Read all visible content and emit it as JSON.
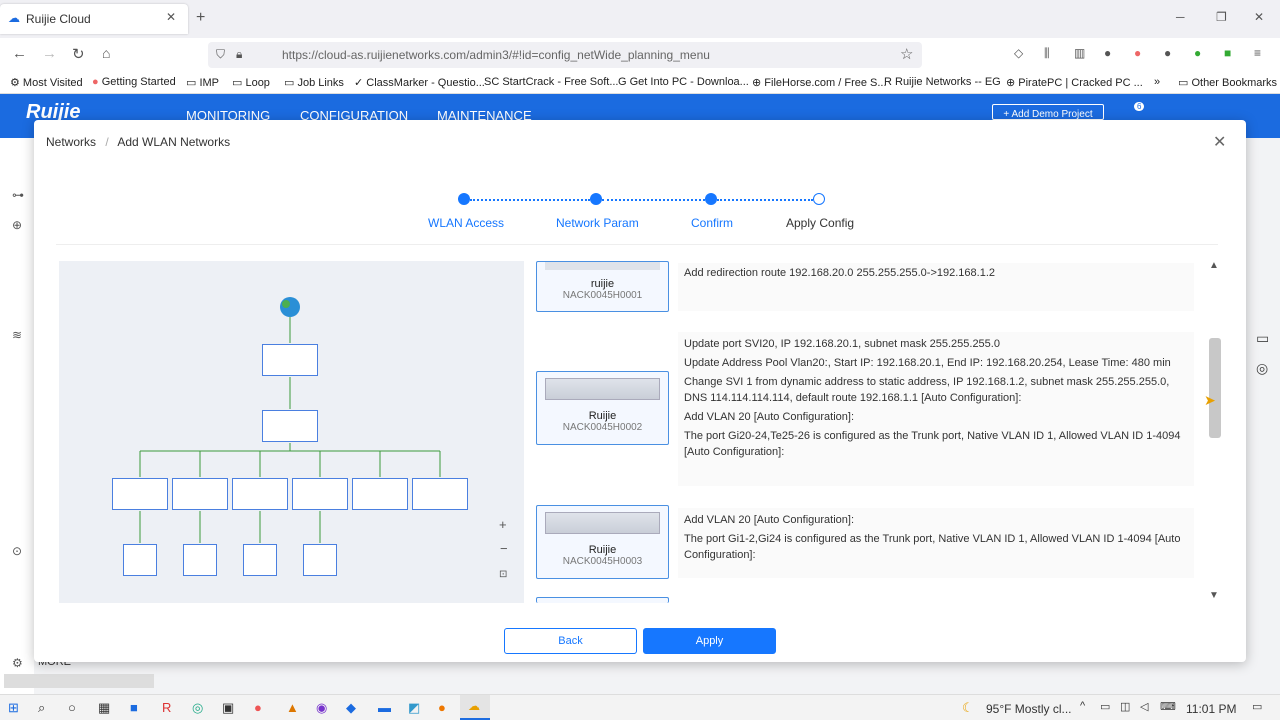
{
  "browser": {
    "tab_title": "Ruijie Cloud",
    "url": "https://cloud-as.ruijienetworks.com/admin3/#!id=config_netWide_planning_menu",
    "bookmarks": [
      "Most Visited",
      "Getting Started",
      "IMP",
      "Loop",
      "Job Links",
      "ClassMarker - Questio...",
      "StartCrack - Free Soft...",
      "Get Into PC - Downloa...",
      "FileHorse.com / Free S...",
      "Ruijie Networks -- EG",
      "PiratePC | Cracked PC ...",
      "Other Bookmarks"
    ]
  },
  "app": {
    "logo": "Ruijie",
    "menu": [
      "MONITORING",
      "CONFIGURATION",
      "MAINTENANCE"
    ],
    "demo_button": "+ Add Demo Project",
    "badge": "6",
    "more": "MORE"
  },
  "modal": {
    "breadcrumb": [
      "Networks",
      "Add WLAN Networks"
    ],
    "steps": [
      "WLAN Access",
      "Network Param",
      "Confirm",
      "Apply Config"
    ],
    "back_label": "Back",
    "apply_label": "Apply"
  },
  "devices": [
    {
      "name": "ruijie",
      "sn": "NACK0045H0001"
    },
    {
      "name": "Ruijie",
      "sn": "NACK0045H0002"
    },
    {
      "name": "Ruijie",
      "sn": "NACK0045H0003"
    }
  ],
  "details": {
    "d1": [
      "Add redirection route 192.168.20.0 255.255.255.0->192.168.1.2"
    ],
    "d2": [
      "Update port SVI20, IP 192.168.20.1, subnet mask 255.255.255.0",
      "Update Address Pool Vlan20:, Start IP: 192.168.20.1, End IP: 192.168.20.254, Lease Time: 480 min",
      "Change SVI 1 from dynamic address to static address, IP 192.168.1.2, subnet mask 255.255.255.0, DNS 114.114.114.114, default route 192.168.1.1 [Auto Configuration]:",
      "Add VLAN 20 [Auto Configuration]:",
      "The port Gi20-24,Te25-26 is configured as the Trunk port, Native VLAN ID 1, Allowed VLAN ID 1-4094 [Auto Configuration]:"
    ],
    "d3": [
      "Add VLAN 20 [Auto Configuration]:",
      "The port Gi1-2,Gi24 is configured as the Trunk port, Native VLAN ID 1, Allowed VLAN ID 1-4094 [Auto Configuration]:"
    ]
  },
  "taskbar": {
    "weather": "95°F  Mostly cl...",
    "time": "11:01 PM"
  },
  "colors": {
    "brand": "#1b6be0",
    "accent": "#1677ff"
  }
}
